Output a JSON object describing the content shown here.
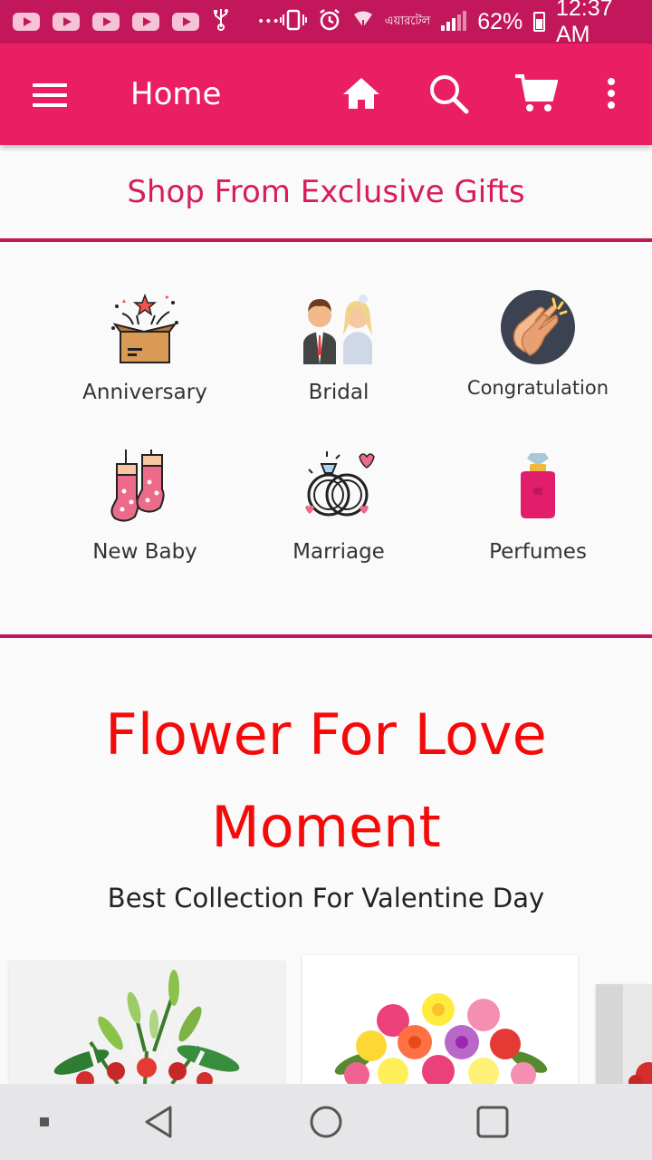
{
  "status_bar": {
    "overflow": "•••",
    "data_label": "এয়ারটেল",
    "battery": "62%",
    "time": "12:37 AM"
  },
  "app_bar": {
    "title": "Home",
    "accent": "#e91e63",
    "icons": [
      "menu-icon",
      "home-icon",
      "search-icon",
      "cart-icon",
      "overflow-menu-icon"
    ]
  },
  "section": {
    "heading": "Shop From Exclusive Gifts"
  },
  "categories": [
    {
      "label": "Anniversary",
      "icon": "gift-box-icon"
    },
    {
      "label": "Bridal",
      "icon": "bride-groom-icon"
    },
    {
      "label": "Congratulation",
      "icon": "clapping-hands-icon"
    },
    {
      "label": "New Baby",
      "icon": "baby-socks-icon"
    },
    {
      "label": "Marriage",
      "icon": "wedding-rings-icon"
    },
    {
      "label": "Perfumes",
      "icon": "perfume-icon"
    }
  ],
  "promo": {
    "title": "Flower For Love Moment",
    "subtitle": "Best Collection For Valentine Day",
    "title_color": "#f50a0a"
  },
  "products": [
    {
      "image": "lily-rose-bouquet"
    },
    {
      "image": "mixed-rose-bouquet"
    },
    {
      "image": "red-rose-bouquet"
    }
  ],
  "nav": {
    "buttons": [
      "recents-dot",
      "back-button",
      "home-button",
      "overview-button"
    ]
  }
}
